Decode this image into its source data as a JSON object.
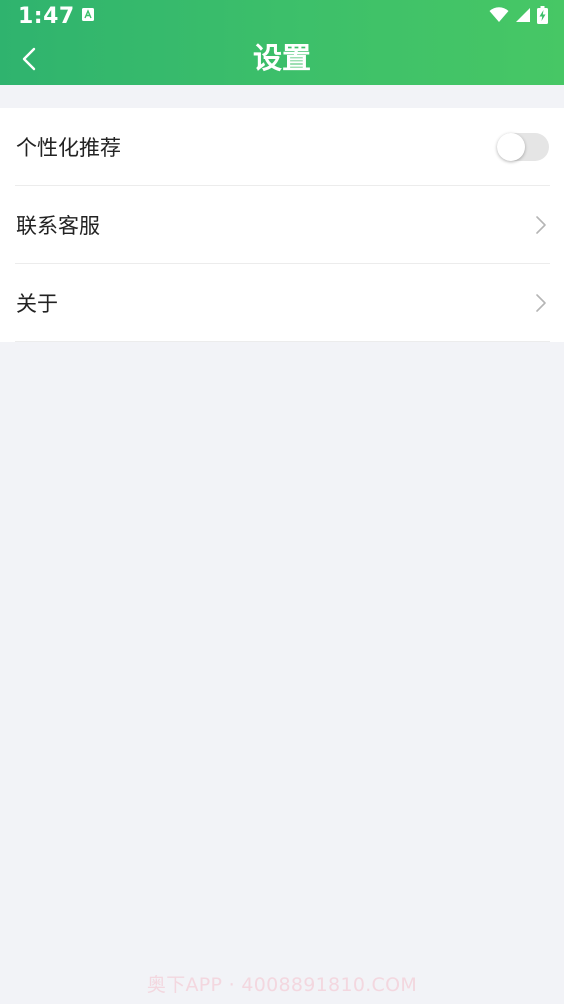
{
  "status_bar": {
    "time": "1:47",
    "icons": [
      "notification-a-icon",
      "wifi-icon",
      "signal-icon",
      "battery-charging-icon"
    ]
  },
  "header": {
    "title": "设置",
    "back_icon": "chevron-left-icon"
  },
  "settings": {
    "items": [
      {
        "label": "个性化推荐",
        "control": "toggle",
        "toggle_on": false
      },
      {
        "label": "联系客服",
        "control": "chevron"
      },
      {
        "label": "关于",
        "control": "chevron"
      }
    ]
  },
  "watermark": "奥下APP · 4008891810.COM",
  "colors": {
    "header_start": "#2fb36e",
    "header_end": "#47c765",
    "background": "#f2f3f7",
    "toggle_off": "#e5e5e5"
  }
}
